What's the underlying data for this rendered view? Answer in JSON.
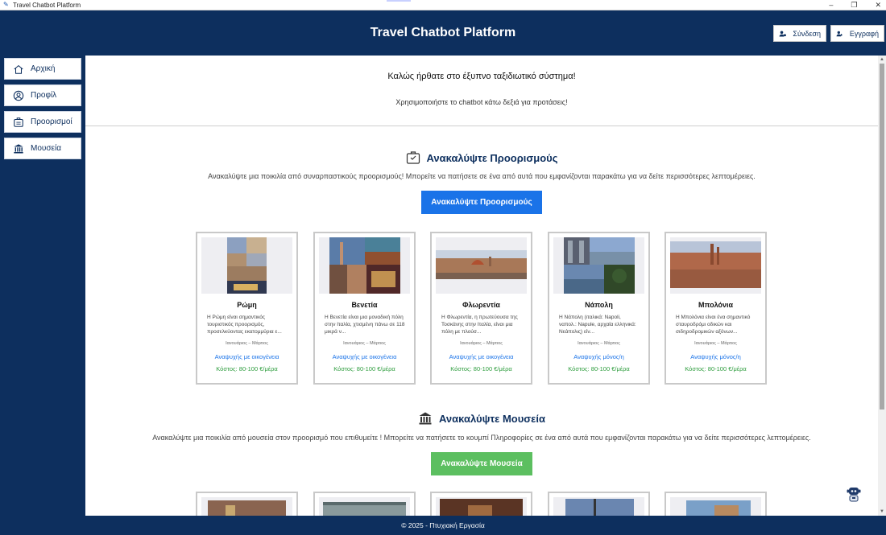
{
  "window": {
    "title": "Travel Chatbot Platform"
  },
  "header": {
    "title": "Travel Chatbot Platform",
    "login_label": "Σύνδεση",
    "register_label": "Εγγραφή"
  },
  "sidebar": {
    "items": [
      {
        "label": "Αρχική",
        "icon": "home-icon"
      },
      {
        "label": "Προφίλ",
        "icon": "user-circle-icon"
      },
      {
        "label": "Προορισμοί",
        "icon": "luggage-icon"
      },
      {
        "label": "Μουσεία",
        "icon": "museum-icon"
      }
    ]
  },
  "welcome": {
    "title": "Καλώς ήρθατε στο έξυπνο ταξιδιωτικό σύστημα!",
    "subtitle": "Χρησιμοποιήστε το chatbot κάτω δεξιά για προτάσεις!"
  },
  "destinations": {
    "title": "Ανακαλύψτε Προορισμούς",
    "description": "Ανακαλύψτε μια ποικιλία από συναρπαστικούς προορισμούς! Μπορείτε να πατήσετε σε ένα από αυτά που εμφανίζονται παρακάτω για να δείτε περισσότερες λεπτομέρειες.",
    "button_label": "Ανακαλύψτε Προορισμούς",
    "button_color": "#1a73e8",
    "cards": [
      {
        "name": "Ρώμη",
        "description": "Η Ρώμη είναι σημαντικός τουριστικός προορισμός, προσελκύοντας εκατομμύρια ε...",
        "season": "Ιανουάριος – Μάρτιος",
        "type": "Αναψυχής με οικογένεια",
        "cost": "Κόστος: 80-100 €/μέρα"
      },
      {
        "name": "Βενετία",
        "description": "Η Βενετία είναι μια μοναδική πόλη στην Ιταλία, χτισμένη πάνω σε 118 μικρά ν...",
        "season": "Ιανουάριος – Μάρτιος",
        "type": "Αναψυχής με οικογένεια",
        "cost": "Κόστος: 80-100 €/μέρα"
      },
      {
        "name": "Φλωρεντία",
        "description": "Η Φλωρεντία, η πρωτεύουσα της Τοσκάνης στην Ιταλία, είναι μια πόλη με πλούσ...",
        "season": "Ιανουάριος – Μάρτιος",
        "type": "Αναψυχής με οικογένεια",
        "cost": "Κόστος: 80-100 €/μέρα"
      },
      {
        "name": "Νάπολη",
        "description": "Η Νάπολη (ιταλικά: Napoli, ναπολ.: Napule, αρχαία ελληνικά: Νεάπολις) είν...",
        "season": "Ιανουάριος – Μάρτιος",
        "type": "Αναψυχής μόνος/η",
        "cost": "Κόστος: 80-100 €/μέρα"
      },
      {
        "name": "Μπολόνια",
        "description": "Η Μπολόνια είναι ένα σημαντικό σταυροδρόμι οδικών και σιδηροδρομικών αξόνων...",
        "season": "Ιανουάριος – Μάρτιος",
        "type": "Αναψυχής μόνος/η",
        "cost": "Κόστος: 80-100 €/μέρα"
      }
    ]
  },
  "museums": {
    "title": "Ανακαλύψτε Μουσεία",
    "description": "Ανακαλύψτε μια ποικιλία από μουσεία στον προορισμό που επιθυμείτε ! Μπορείτε να πατήσετε το κουμπί Πληροφορίες σε ένα από αυτά που εμφανίζονται παρακάτω για να δείτε περισσότερες λεπτομέρειες.",
    "button_label": "Ανακαλύψτε Μουσεία",
    "button_color": "#5cbf60"
  },
  "footer": {
    "text": "© 2025 - Πτυχιακή Εργασία"
  },
  "colors": {
    "brand": "#0d2f5e",
    "link": "#1a73e8",
    "cost": "#2e9d3e"
  }
}
